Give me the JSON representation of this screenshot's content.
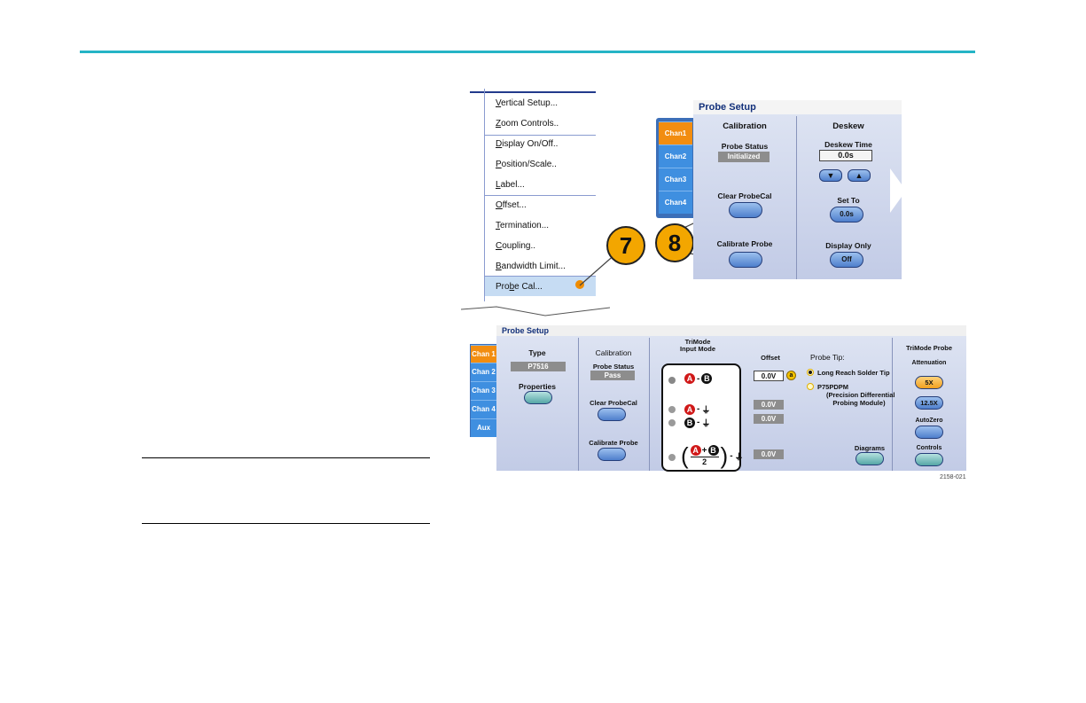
{
  "menu": {
    "items": [
      {
        "pre": "",
        "u": "V",
        "rest": "ertical Setup..."
      },
      {
        "pre": "",
        "u": "Z",
        "rest": "oom Controls.."
      },
      {
        "pre": "",
        "u": "D",
        "rest": "isplay On/Off.."
      },
      {
        "pre": "",
        "u": "P",
        "rest": "osition/Scale.."
      },
      {
        "pre": "",
        "u": "L",
        "rest": "abel..."
      },
      {
        "pre": "",
        "u": "O",
        "rest": "ffset..."
      },
      {
        "pre": "",
        "u": "T",
        "rest": "ermination..."
      },
      {
        "pre": "",
        "u": "C",
        "rest": "oupling.."
      },
      {
        "pre": "",
        "u": "B",
        "rest": "andwidth Limit..."
      },
      {
        "pre": "Pro",
        "u": "b",
        "rest": "e Cal..."
      }
    ]
  },
  "callouts": [
    "7",
    "8"
  ],
  "probe_setup_top": {
    "title": "Probe Setup",
    "tabs": [
      "Chan1",
      "Chan2",
      "Chan3",
      "Chan4"
    ],
    "calibration": {
      "heading": "Calibration",
      "status_label": "Probe Status",
      "status_value": "Initialized",
      "clear_label": "Clear ProbeCal",
      "calibrate_label": "Calibrate Probe"
    },
    "deskew": {
      "heading": "Deskew",
      "time_label": "Deskew Time",
      "time_value": "0.0s",
      "set_to_label": "Set To",
      "set_to_value": "0.0s",
      "display_only_label": "Display Only",
      "display_only_value": "Off"
    }
  },
  "probe_setup_bottom": {
    "title": "Probe Setup",
    "tabs": [
      "Chan 1",
      "Chan 2",
      "Chan 3",
      "Chan 4",
      "Aux"
    ],
    "type": {
      "heading": "Type",
      "value": "P7516",
      "properties_label": "Properties"
    },
    "calibration": {
      "heading": "Calibration",
      "status_label": "Probe Status",
      "status_value": "Pass",
      "clear_label": "Clear ProbeCal",
      "calibrate_label": "Calibrate Probe"
    },
    "trimode": {
      "heading_line1": "TriMode",
      "heading_line2": "Input Mode",
      "letter_a": "A",
      "letter_b": "B",
      "minus": "-",
      "plus": "+",
      "ground": "⏚",
      "denominator": "2"
    },
    "offset": {
      "heading": "Offset",
      "values": [
        "0.0V",
        "0.0V",
        "0.0V",
        "0.0V"
      ],
      "suffix": "a"
    },
    "probe_tip": {
      "heading": "Probe Tip:",
      "option1": "Long Reach Solder Tip",
      "option2_line1": "P75PDPM",
      "option2_line2": "(Precision Differential",
      "option2_line3": "Probing Module)",
      "diagrams_label": "Diagrams"
    },
    "trimode_probe": {
      "heading": "TriMode Probe",
      "attenuation_label": "Attenuation",
      "att_5x": "5X",
      "att_125x": "12.5X",
      "autozero_label": "AutoZero",
      "controls_label": "Controls"
    }
  },
  "figure_code": "2158-021",
  "colors": {
    "accent": "#25b4c6",
    "active_tab": "#f28d10",
    "tab": "#3f8fe0",
    "callout": "#f3a600"
  }
}
